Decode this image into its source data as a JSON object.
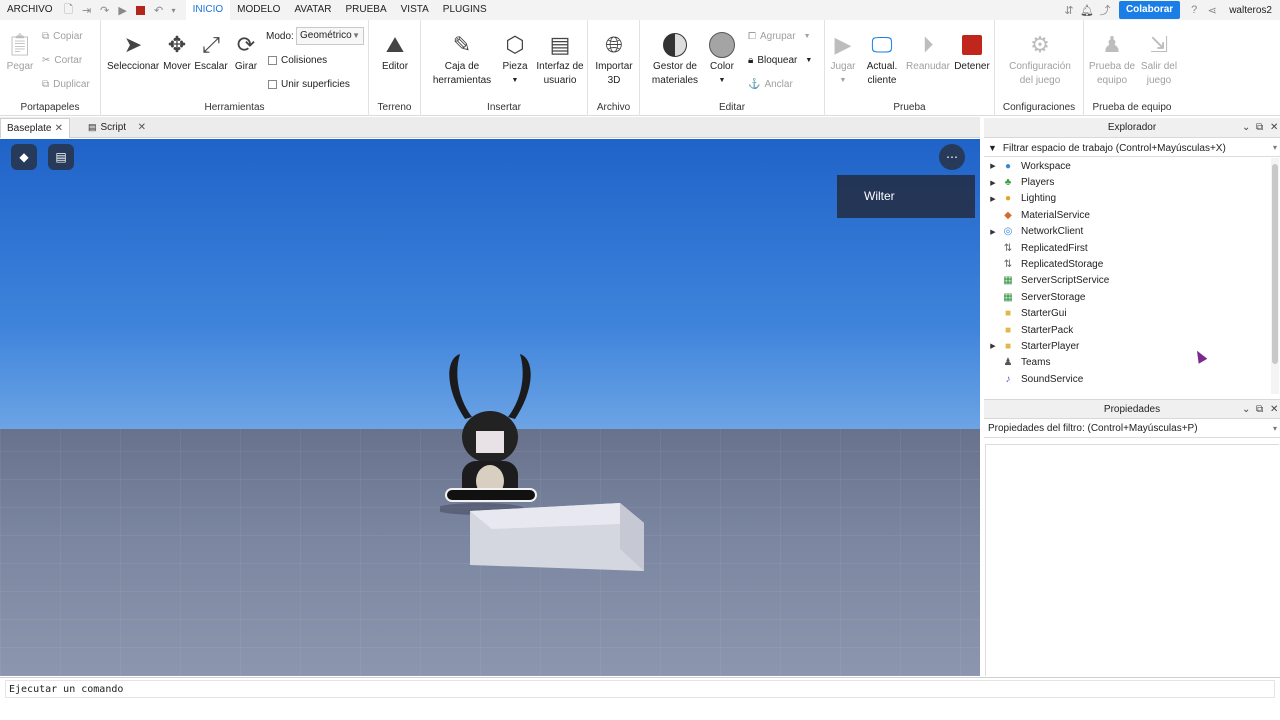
{
  "menu": {
    "file": "ARCHIVO",
    "tabs": [
      "INICIO",
      "MODELO",
      "AVATAR",
      "PRUEBA",
      "VISTA",
      "PLUGINS"
    ],
    "active_tab": "INICIO",
    "collaborate": "Colaborar",
    "username": "walteros2"
  },
  "ribbon": {
    "clipboard": {
      "paste": "Pegar",
      "copy": "Copiar",
      "cut": "Cortar",
      "duplicate": "Duplicar",
      "label": "Portapapeles"
    },
    "tools": {
      "select": "Seleccionar",
      "move": "Mover",
      "scale": "Escalar",
      "rotate": "Girar",
      "mode_label": "Modo:",
      "mode_value": "Geométrico",
      "collisions": "Colisiones",
      "join_surfaces": "Unir superficies",
      "label": "Herramientas"
    },
    "terrain": {
      "editor": "Editor",
      "label": "Terreno"
    },
    "insert": {
      "toolbox_1": "Caja de",
      "toolbox_2": "herramientas",
      "part": "Pieza",
      "ui_1": "Interfaz de",
      "ui_2": "usuario",
      "label": "Insertar"
    },
    "file": {
      "import_1": "Importar",
      "import_2": "3D",
      "label": "Archivo"
    },
    "edit": {
      "material_1": "Gestor de",
      "material_2": "materiales",
      "color": "Color",
      "group": "Agrupar",
      "lock": "Bloquear",
      "anchor": "Anclar",
      "label": "Editar"
    },
    "test": {
      "play": "Jugar",
      "update_1": "Actual.",
      "update_2": "cliente",
      "resume": "Reanudar",
      "stop": "Detener",
      "label": "Prueba"
    },
    "settings": {
      "game_1": "Configuración",
      "game_2": "del juego",
      "label": "Configuraciones"
    },
    "team_test": {
      "test_1": "Prueba de",
      "test_2": "equipo",
      "exit_1": "Salir del",
      "exit_2": "juego",
      "label": "Prueba de equipo"
    }
  },
  "doc_tabs": [
    "Baseplate",
    "Script"
  ],
  "viewport": {
    "player_name": "Wilter"
  },
  "explorer": {
    "title": "Explorador",
    "filter": "Filtrar espacio de trabajo (Control+Mayúsculas+X)",
    "items": [
      {
        "name": "Workspace",
        "expandable": true,
        "icon": "globe-icon",
        "color": "#3a86d8"
      },
      {
        "name": "Players",
        "expandable": true,
        "icon": "players-icon",
        "color": "#3f9f3f"
      },
      {
        "name": "Lighting",
        "expandable": true,
        "icon": "lightbulb-icon",
        "color": "#e2a21c"
      },
      {
        "name": "MaterialService",
        "expandable": false,
        "icon": "material-icon",
        "color": "#d36b2a"
      },
      {
        "name": "NetworkClient",
        "expandable": true,
        "icon": "network-icon",
        "color": "#3a86d8"
      },
      {
        "name": "ReplicatedFirst",
        "expandable": false,
        "icon": "replicated-first-icon",
        "color": "#666666"
      },
      {
        "name": "ReplicatedStorage",
        "expandable": false,
        "icon": "replicated-storage-icon",
        "color": "#666666"
      },
      {
        "name": "ServerScriptService",
        "expandable": false,
        "icon": "server-script-icon",
        "color": "#2f8f3f"
      },
      {
        "name": "ServerStorage",
        "expandable": false,
        "icon": "server-storage-icon",
        "color": "#2f8f3f"
      },
      {
        "name": "StarterGui",
        "expandable": false,
        "icon": "folder-icon",
        "color": "#e0b84a"
      },
      {
        "name": "StarterPack",
        "expandable": false,
        "icon": "folder-icon",
        "color": "#e0b84a"
      },
      {
        "name": "StarterPlayer",
        "expandable": true,
        "icon": "starter-player-icon",
        "color": "#e0b84a"
      },
      {
        "name": "Teams",
        "expandable": false,
        "icon": "teams-icon",
        "color": "#555555"
      },
      {
        "name": "SoundService",
        "expandable": false,
        "icon": "sound-icon",
        "color": "#4a5ac8"
      }
    ]
  },
  "properties": {
    "title": "Propiedades",
    "filter": "Propiedades del filtro: (Control+Mayúsculas+P)"
  },
  "command": {
    "placeholder": "Ejecutar un comando"
  }
}
